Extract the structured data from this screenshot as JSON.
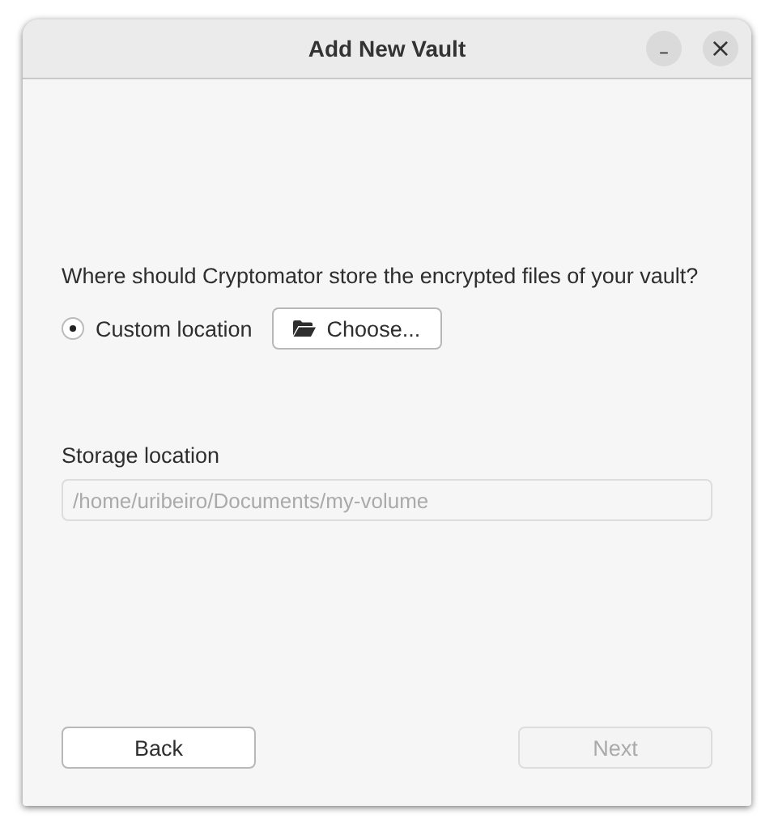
{
  "window": {
    "title": "Add New Vault",
    "controls": [
      {
        "kind": "minimize",
        "glyph": "–"
      },
      {
        "kind": "close",
        "glyph": "×"
      }
    ]
  },
  "question": "Where should Cryptomator store the encrypted files of your vault?",
  "location_options": [
    {
      "label": "Custom location",
      "selected": true
    }
  ],
  "choose_button": {
    "label": "Choose..."
  },
  "storage": {
    "label": "Storage location",
    "value": "/home/uribeiro/Documents/my-volume",
    "disabled": true
  },
  "buttons": [
    {
      "label": "Back",
      "disabled": false
    },
    {
      "label": "Next",
      "disabled": true
    }
  ]
}
